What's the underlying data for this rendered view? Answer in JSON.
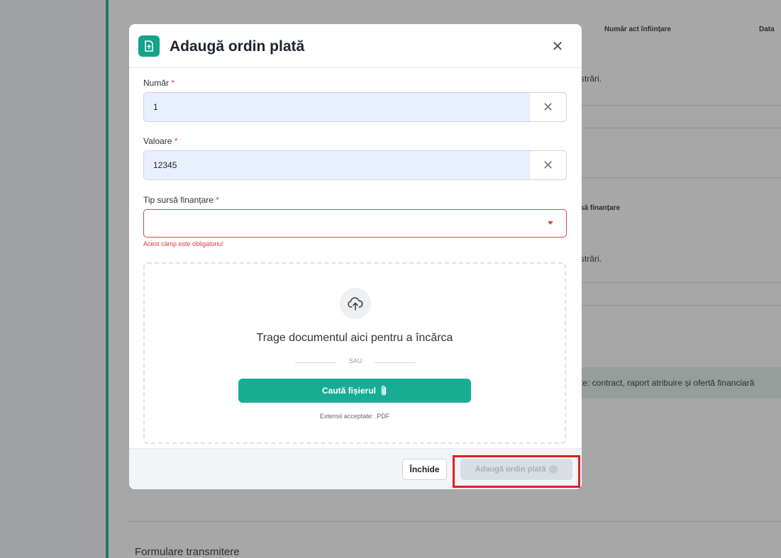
{
  "background": {
    "columns": {
      "numar_act": "Număr act înființare",
      "data": "Data"
    },
    "rows": {
      "row1": "strări.",
      "row2": "să finanțare",
      "row3": "strări."
    },
    "info_text": "te: contract, raport atribuire și ofertă financiară",
    "section_title": "Formulare transmitere"
  },
  "modal": {
    "title": "Adaugă ordin plată",
    "fields": {
      "numar": {
        "label": "Număr",
        "required": "*",
        "value": "1"
      },
      "valoare": {
        "label": "Valoare",
        "required": "*",
        "value": "12345"
      },
      "tip_sursa": {
        "label": "Tip sursă finanțare",
        "required": "*",
        "value": "",
        "error": "Acest câmp este obligatoriu!"
      }
    },
    "dropzone": {
      "title": "Trage documentul aici pentru a încărca",
      "separator": "SAU",
      "browse_label": "Caută fișierul",
      "extensions": "Extensii acceptate: .PDF"
    },
    "footer": {
      "close_label": "Închide",
      "add_label": "Adaugă ordin plată"
    }
  },
  "colors": {
    "accent": "#17ad94",
    "error": "#e04545",
    "highlight": "#e21f1f"
  }
}
